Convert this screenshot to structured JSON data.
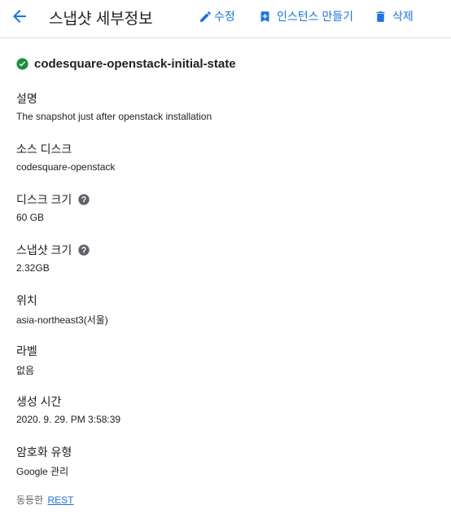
{
  "header": {
    "title": "스냅샷 세부정보",
    "actions": {
      "edit": "수정",
      "create_instance": "인스턴스 만들기",
      "delete": "삭제"
    }
  },
  "snapshot": {
    "name": "codesquare-openstack-initial-state",
    "status": "ready",
    "status_color": "#1e8e3e"
  },
  "fields": {
    "description": {
      "label": "설명",
      "value": "The snapshot just after openstack installation"
    },
    "source_disk": {
      "label": "소스 디스크",
      "value": "codesquare-openstack"
    },
    "disk_size": {
      "label": "디스크 크기",
      "value": "60 GB"
    },
    "snapshot_size": {
      "label": "스냅샷 크기",
      "value": "2.32GB"
    },
    "location": {
      "label": "위치",
      "value": "asia-northeast3(서울)"
    },
    "labels": {
      "label": "라벨",
      "value": "없음"
    },
    "created": {
      "label": "생성 시간",
      "value": "2020. 9. 29. PM 3:58:39"
    },
    "encryption": {
      "label": "암호화 유형",
      "value": "Google 관리"
    }
  },
  "footer": {
    "equivalent_text": "동등한",
    "rest_link": "REST"
  },
  "colors": {
    "accent": "#1a73e8",
    "text": "#202124",
    "muted": "#5f6368"
  }
}
